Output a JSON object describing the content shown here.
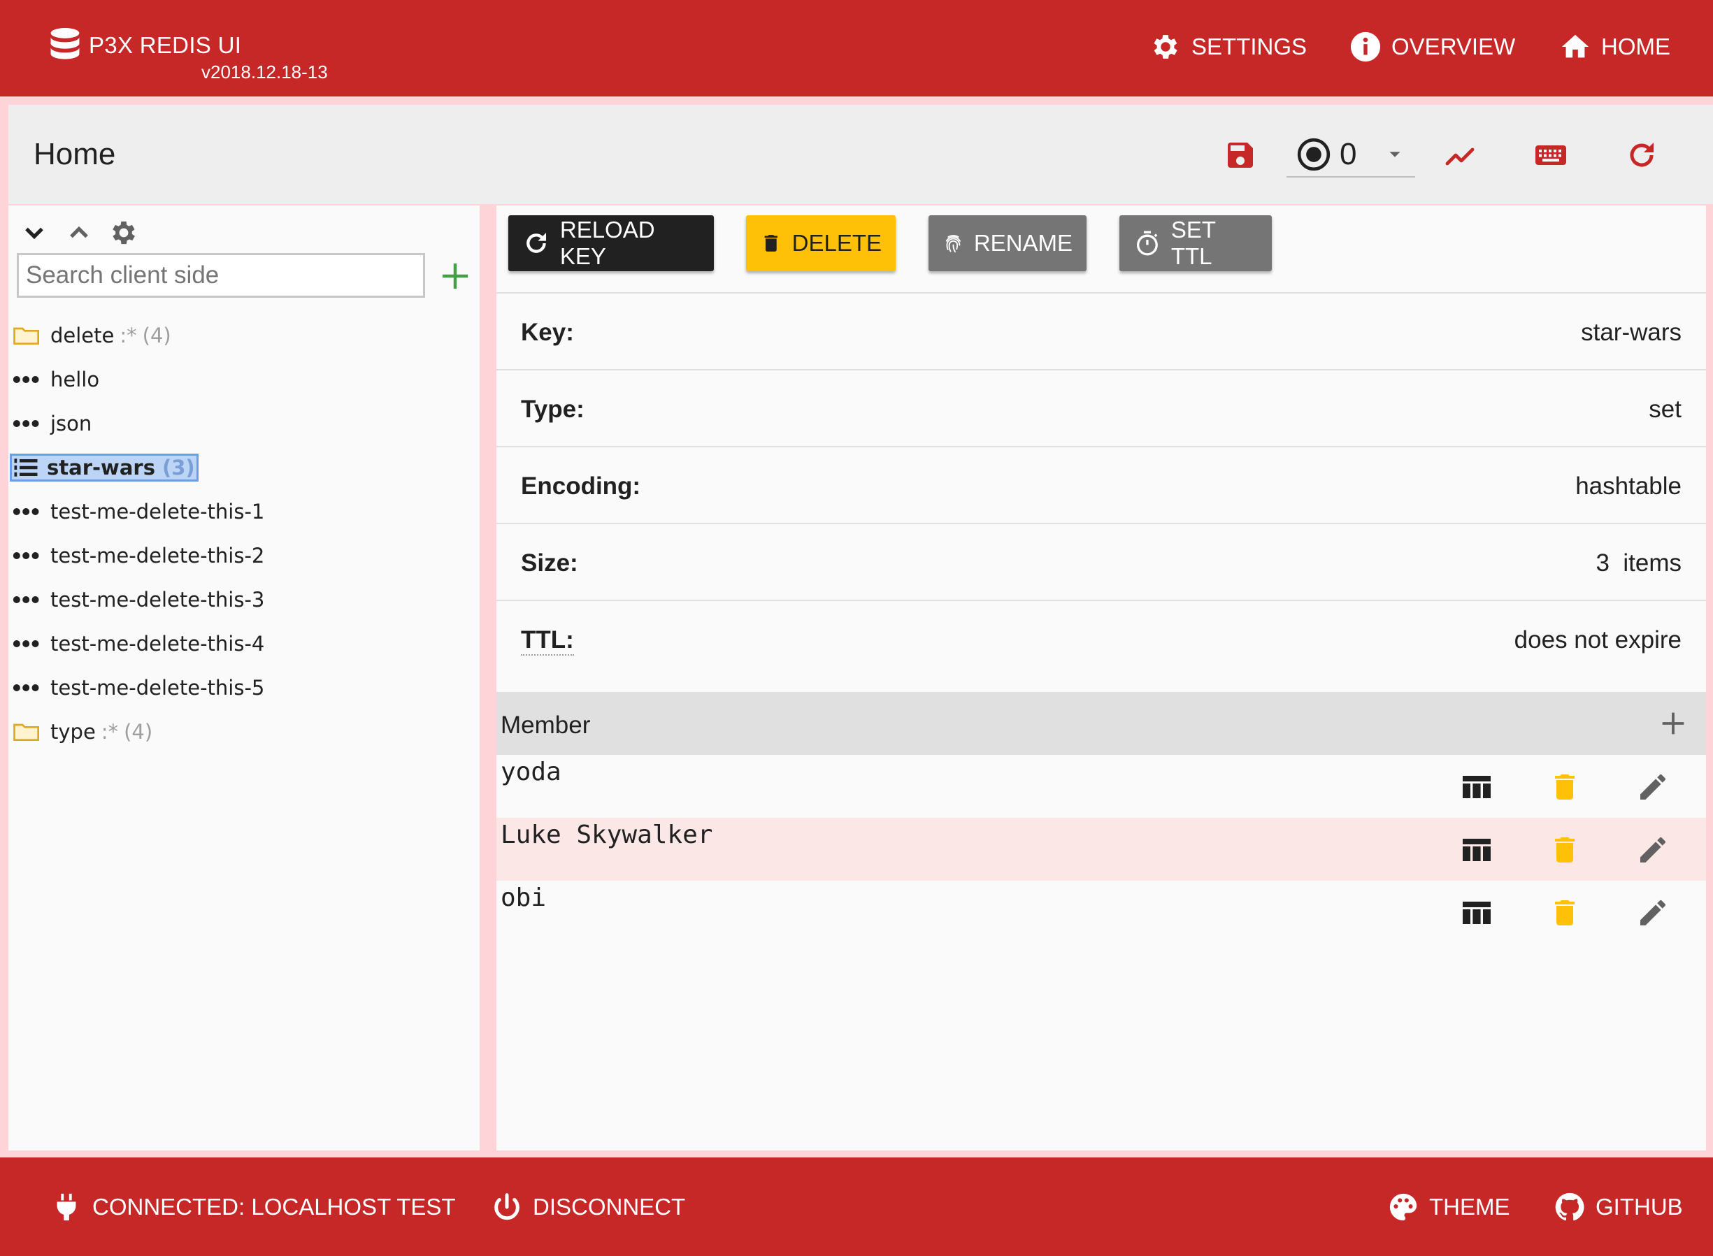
{
  "app": {
    "title": "P3X REDIS UI",
    "version": "v2018.12.18-13"
  },
  "topnav": {
    "settings": "SETTINGS",
    "overview": "OVERVIEW",
    "home": "HOME"
  },
  "home": {
    "title": "Home",
    "db_index": "0"
  },
  "search": {
    "placeholder": "Search client side",
    "value": ""
  },
  "tree": [
    {
      "type": "folder",
      "label": "delete",
      "pattern": ":*",
      "count": "(4)"
    },
    {
      "type": "key",
      "label": "hello"
    },
    {
      "type": "key",
      "label": "json"
    },
    {
      "type": "set",
      "label": "star-wars",
      "count": "(3)",
      "selected": true
    },
    {
      "type": "key",
      "label": "test-me-delete-this-1"
    },
    {
      "type": "key",
      "label": "test-me-delete-this-2"
    },
    {
      "type": "key",
      "label": "test-me-delete-this-3"
    },
    {
      "type": "key",
      "label": "test-me-delete-this-4"
    },
    {
      "type": "key",
      "label": "test-me-delete-this-5"
    },
    {
      "type": "folder",
      "label": "type",
      "pattern": ":*",
      "count": "(4)"
    }
  ],
  "actions": {
    "reload": "RELOAD KEY",
    "delete": "DELETE",
    "rename": "RENAME",
    "set_ttl": "SET TTL"
  },
  "key_info": [
    {
      "label": "Key:",
      "value": "star-wars"
    },
    {
      "label": "Type:",
      "value": "set"
    },
    {
      "label": "Encoding:",
      "value": "hashtable"
    },
    {
      "label": "Size:",
      "value": "3  items"
    },
    {
      "label": "TTL:",
      "value": "does not expire"
    }
  ],
  "members": {
    "header": "Member",
    "rows": [
      "yoda",
      "Luke Skywalker",
      "obi"
    ]
  },
  "footer": {
    "connected": "CONNECTED: LOCALHOST TEST",
    "disconnect": "DISCONNECT",
    "theme": "THEME",
    "github": "GITHUB"
  },
  "colors": {
    "primary": "#c62828",
    "accent": "#ffc107",
    "dark_button": "#212121",
    "grey_button": "#757575",
    "add_green": "#43a047"
  }
}
